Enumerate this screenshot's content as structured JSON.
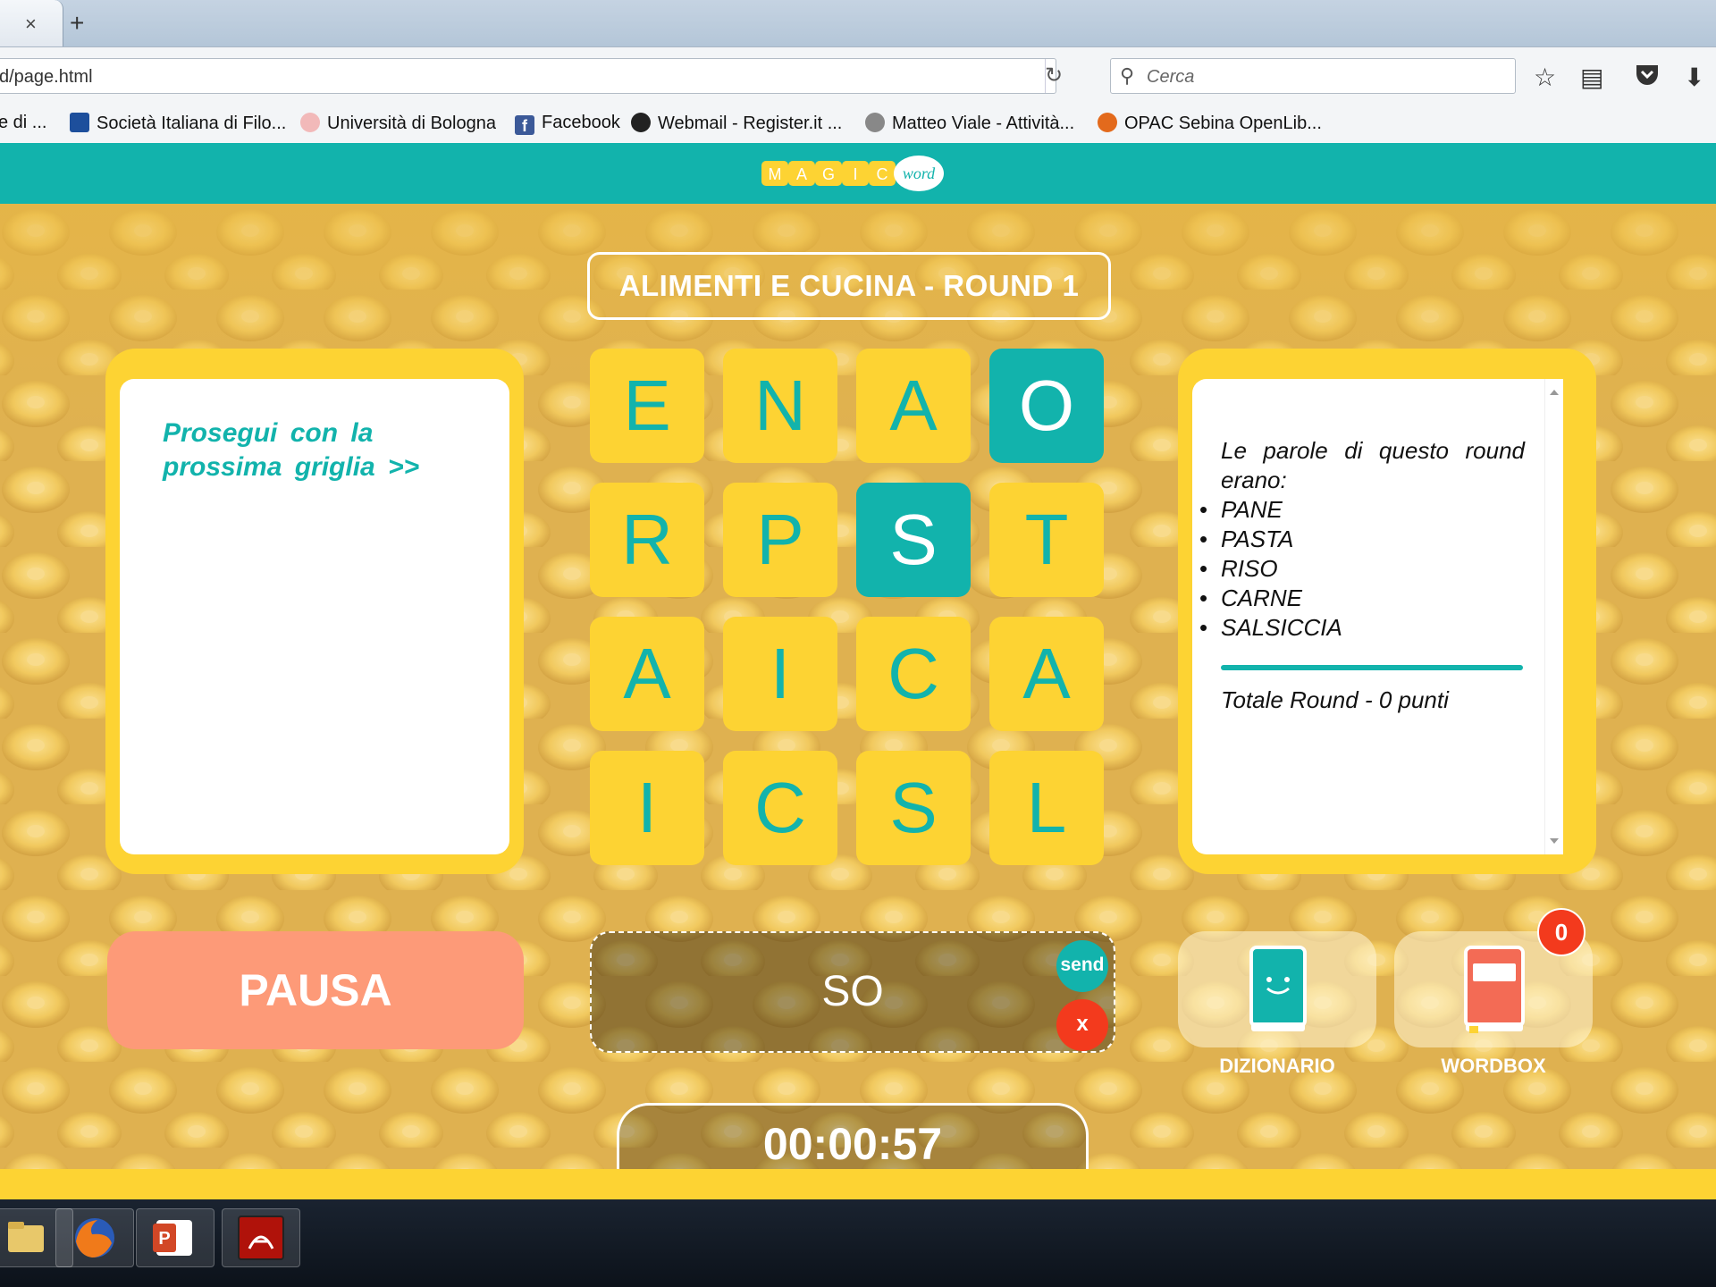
{
  "browser": {
    "tab_close": "×",
    "tab_new": "+",
    "url": "d/page.html",
    "search_placeholder": "Cerca",
    "bookmarks": [
      {
        "label": "e di ..."
      },
      {
        "label": "Società Italiana di Filo..."
      },
      {
        "label": "Università di Bologna"
      },
      {
        "label": "Facebook"
      },
      {
        "label": "Webmail - Register.it ..."
      },
      {
        "label": "Matteo Viale - Attività..."
      },
      {
        "label": "OPAC Sebina OpenLib..."
      }
    ]
  },
  "header": {
    "logo_letters": [
      "M",
      "A",
      "G",
      "I",
      "C"
    ],
    "logo_word": "word"
  },
  "game": {
    "round_title": "ALIMENTI E CUCINA - ROUND 1",
    "left_message": "Prosegui con la prossima griglia >>",
    "grid": [
      [
        "E",
        "N",
        "A",
        "O"
      ],
      [
        "R",
        "P",
        "S",
        "T"
      ],
      [
        "A",
        "I",
        "C",
        "A"
      ],
      [
        "I",
        "C",
        "S",
        "L"
      ]
    ],
    "highlighted_tiles": [
      "O",
      "S"
    ],
    "right_panel": {
      "intro": "Le parole di questo round erano:",
      "words": [
        "PANE",
        "PASTA",
        "RISO",
        "CARNE",
        "SALSICCIA"
      ],
      "total": "Totale Round - 0 punti"
    },
    "pause_label": "PAUSA",
    "current_word": "SO",
    "send_label": "send",
    "clear_label": "x",
    "tools": {
      "dictionary_label": "DIZIONARIO",
      "wordbox_label": "WORDBOX",
      "wordbox_count": "0"
    },
    "timer": "00:00:57"
  },
  "colors": {
    "teal": "#12b3ac",
    "yellow": "#fdd333",
    "salmon": "#fd9a78",
    "red": "#f33a1d"
  }
}
